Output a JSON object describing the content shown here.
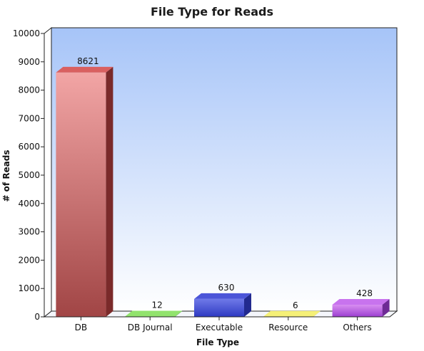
{
  "chart_data": {
    "type": "bar",
    "title": "File Type for Reads",
    "xlabel": "File Type",
    "ylabel": "# of Reads",
    "categories": [
      "DB",
      "DB Journal",
      "Executable",
      "Resource",
      "Others"
    ],
    "values": [
      8621,
      12,
      630,
      6,
      428
    ],
    "data_labels": [
      "8621",
      "12",
      "630",
      "6",
      "428"
    ],
    "ylim": [
      0,
      10000
    ],
    "yticks": [
      "0",
      "1000",
      "2000",
      "3000",
      "4000",
      "5000",
      "6000",
      "7000",
      "8000",
      "9000",
      "10000"
    ],
    "grid": false,
    "legend": "none",
    "style": "3d-bar",
    "colors": {
      "background_top": "#a6c4f8",
      "background_bottom": "#ffffff",
      "bars": [
        {
          "light": "#f2a5a5",
          "dark": "#a14545",
          "top": "#d96060",
          "side": "#7a2a2a"
        },
        {
          "light": "#8be06a",
          "dark": "#4cb52b",
          "top": "#92e36d",
          "side": "#3f8f24"
        },
        {
          "light": "#6f79e8",
          "dark": "#2e3ac2",
          "top": "#4b55d8",
          "side": "#222a8f"
        },
        {
          "light": "#f6f38a",
          "dark": "#e2dc3a",
          "top": "#f5f077",
          "side": "#b0aa20"
        },
        {
          "light": "#d88ef1",
          "dark": "#9c3fd0",
          "top": "#c873ee",
          "side": "#6e2a95"
        }
      ]
    }
  }
}
